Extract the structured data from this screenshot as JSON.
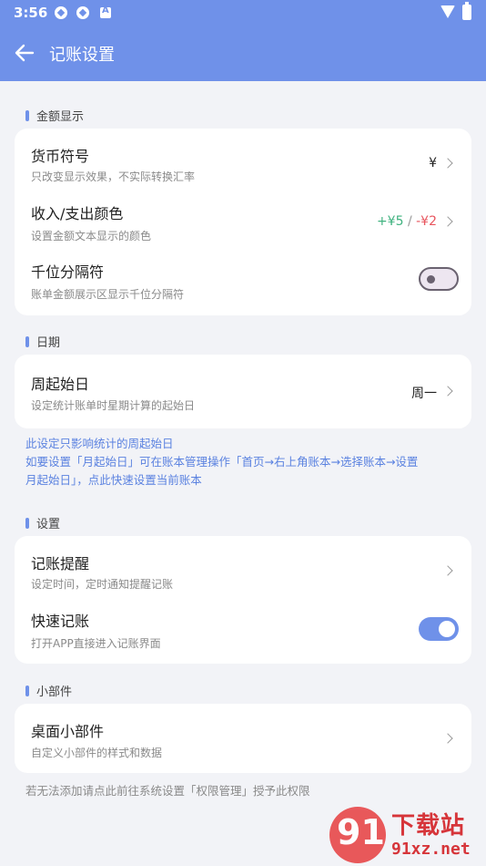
{
  "status_bar": {
    "time": "3:56"
  },
  "header": {
    "title": "记账设置"
  },
  "sections": {
    "amount": {
      "label": "金额显示",
      "currency": {
        "title": "货币符号",
        "subtitle": "只改变显示效果，不实际转换汇率",
        "value": "¥"
      },
      "color": {
        "title": "收入/支出颜色",
        "subtitle": "设置金额文本显示的颜色",
        "income_value": "+¥5",
        "separator": "/",
        "expense_value": "-¥2",
        "income_color": "#3fb27f",
        "expense_color": "#e8555e"
      },
      "thousands": {
        "title": "千位分隔符",
        "subtitle": "账单金额展示区显示千位分隔符",
        "enabled": false
      }
    },
    "date": {
      "label": "日期",
      "week_start": {
        "title": "周起始日",
        "subtitle": "设定统计账单时星期计算的起始日",
        "value": "周一"
      },
      "note_line1": "此设定只影响统计的周起始日",
      "note_line2": "如要设置「月起始日」可在账本管理操作「首页→右上角账本→选择账本→设置",
      "note_line3": "月起始日」，点此快速设置当前账本"
    },
    "settings": {
      "label": "设置",
      "reminder": {
        "title": "记账提醒",
        "subtitle": "设定时间，定时通知提醒记账"
      },
      "quick": {
        "title": "快速记账",
        "subtitle": "打开APP直接进入记账界面",
        "enabled": true
      }
    },
    "widget": {
      "label": "小部件",
      "desktop": {
        "title": "桌面小部件",
        "subtitle": "自定义小部件的样式和数据"
      },
      "footer": "若无法添加请点此前往系统设置「权限管理」授予此权限"
    }
  },
  "watermark": {
    "logo": "91",
    "big": "下载站",
    "small": "91xz.net"
  },
  "colors": {
    "accent": "#6f91e9",
    "background": "#f2f3f7"
  }
}
